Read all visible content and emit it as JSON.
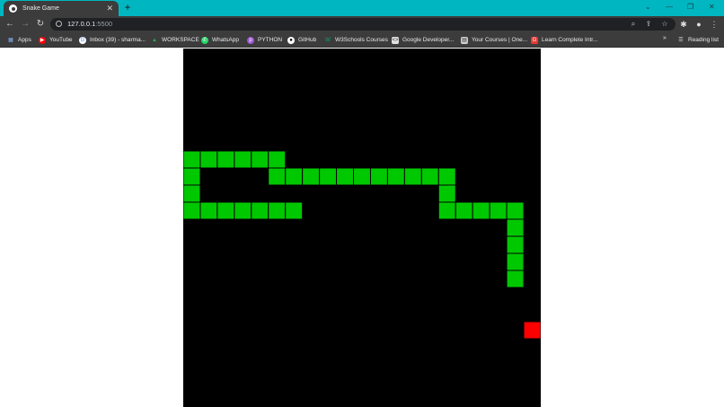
{
  "browser": {
    "tab": {
      "title": "Snake Game",
      "favicon": "globe-icon"
    },
    "new_tab_symbol": "+",
    "window_controls": {
      "dropdown": "⌄",
      "minimize": "—",
      "restore": "❐",
      "close": "✕"
    },
    "address": {
      "host": "127.0.0.1",
      "port": ":5500"
    },
    "bookmarks": [
      {
        "label": "Apps",
        "icon": "apps-grid-icon",
        "color": "#8ab4f8"
      },
      {
        "label": "YouTube",
        "icon": "youtube-icon",
        "color": "#ff0000"
      },
      {
        "label": "Inbox (39) - sharma...",
        "icon": "google-icon",
        "color": "#ffffff"
      },
      {
        "label": "WORKSPACE",
        "icon": "drive-icon",
        "color": "#34a853"
      },
      {
        "label": "WhatsApp",
        "icon": "whatsapp-icon",
        "color": "#25d366"
      },
      {
        "label": "PYTHON",
        "icon": "python-icon",
        "color": "#9b59d0"
      },
      {
        "label": "GitHub",
        "icon": "github-icon",
        "color": "#ffffff"
      },
      {
        "label": "W3Schools Courses",
        "icon": "w3schools-icon",
        "color": "#04aa6d"
      },
      {
        "label": "Google Developer...",
        "icon": "google-dev-icon",
        "color": "#e0e0e0"
      },
      {
        "label": "Your Courses | One...",
        "icon": "courses-icon",
        "color": "#cfcfcf"
      },
      {
        "label": "Learn Complete Intr...",
        "icon": "learn-icon",
        "color": "#e53935"
      }
    ],
    "bookmarks_more": "»",
    "reading_list": "Reading list"
  },
  "game": {
    "colors": {
      "background": "#000000",
      "snake": "#00c800",
      "food": "#ff0000",
      "cell_border": "#000000"
    },
    "grid_cols": 21,
    "grid_rows": 21,
    "snake_cells": [
      [
        0,
        6
      ],
      [
        1,
        6
      ],
      [
        2,
        6
      ],
      [
        3,
        6
      ],
      [
        4,
        6
      ],
      [
        5,
        6
      ],
      [
        0,
        7
      ],
      [
        5,
        7
      ],
      [
        6,
        7
      ],
      [
        7,
        7
      ],
      [
        8,
        7
      ],
      [
        9,
        7
      ],
      [
        10,
        7
      ],
      [
        11,
        7
      ],
      [
        12,
        7
      ],
      [
        13,
        7
      ],
      [
        14,
        7
      ],
      [
        15,
        7
      ],
      [
        0,
        8
      ],
      [
        15,
        8
      ],
      [
        0,
        9
      ],
      [
        1,
        9
      ],
      [
        2,
        9
      ],
      [
        3,
        9
      ],
      [
        4,
        9
      ],
      [
        5,
        9
      ],
      [
        6,
        9
      ],
      [
        15,
        9
      ],
      [
        16,
        9
      ],
      [
        17,
        9
      ],
      [
        18,
        9
      ],
      [
        19,
        9
      ],
      [
        19,
        10
      ],
      [
        19,
        11
      ],
      [
        19,
        12
      ],
      [
        19,
        13
      ]
    ],
    "food_cell": [
      20,
      16
    ]
  }
}
